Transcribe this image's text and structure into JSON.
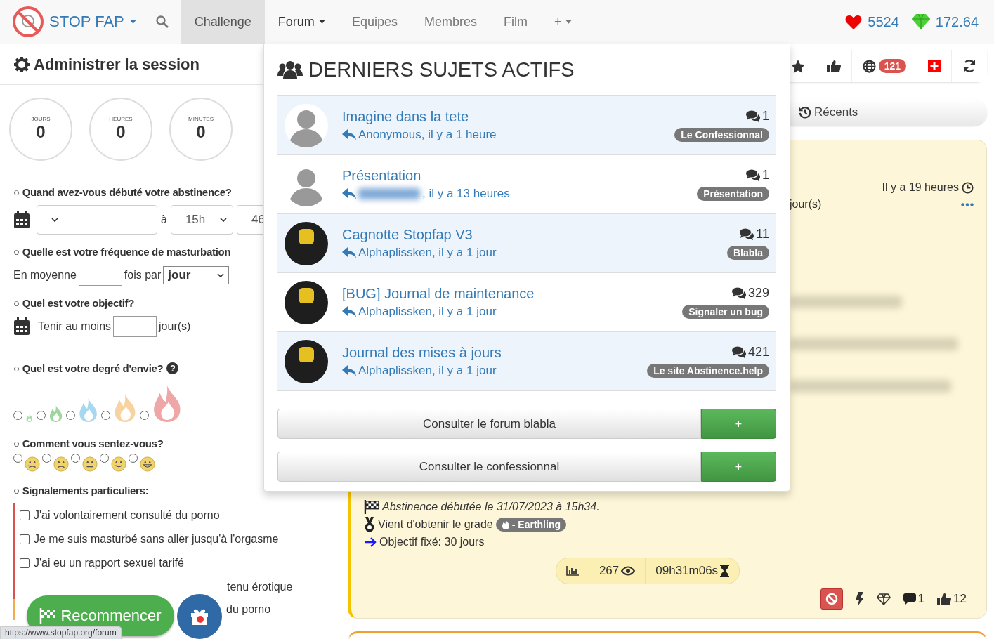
{
  "nav": {
    "brand": "STOP FAP",
    "tabs": [
      {
        "label": "Challenge",
        "selected": true,
        "open": false,
        "dropdown": false
      },
      {
        "label": "Forum",
        "selected": false,
        "open": true,
        "dropdown": true
      },
      {
        "label": "Equipes",
        "selected": false,
        "open": false,
        "dropdown": false
      },
      {
        "label": "Membres",
        "selected": false,
        "open": false,
        "dropdown": false
      },
      {
        "label": "Film",
        "selected": false,
        "open": false,
        "dropdown": false
      },
      {
        "label": "+",
        "selected": false,
        "open": false,
        "dropdown": true
      }
    ],
    "hearts": "5524",
    "gems": "172.64"
  },
  "session": {
    "title": "Administrer la session",
    "counters": [
      {
        "label": "JOURS",
        "value": "0"
      },
      {
        "label": "HEURES",
        "value": "0"
      },
      {
        "label": "MINUTES",
        "value": "0"
      }
    ]
  },
  "form": {
    "bullet": "○",
    "start": {
      "question": "Quand avez-vous débuté votre abstinence?",
      "joiner": "à",
      "hour": "15h",
      "minute": "46"
    },
    "frequency": {
      "question": "Quelle est votre fréquence de masturbation",
      "prefix": "En moyenne",
      "middle": "fois par",
      "unit": "jour"
    },
    "goal": {
      "question": "Quel est votre objectif?",
      "prefix": "Tenir au moins",
      "suffix": "jour(s)"
    },
    "desire": {
      "question": "Quel est votre degré d'envie?",
      "help": "?",
      "levels": [
        {
          "selected": false,
          "color": "#a8dca8"
        },
        {
          "selected": false,
          "color": "#9fd69f"
        },
        {
          "selected": false,
          "color": "#a6d8ef"
        },
        {
          "selected": false,
          "color": "#f7d3a2"
        },
        {
          "selected": false,
          "color": "#eea6a6"
        }
      ]
    },
    "mood": {
      "question": "Comment vous sentez-vous?",
      "options": [
        {
          "selected": false
        },
        {
          "selected": false
        },
        {
          "selected": false
        },
        {
          "selected": false
        },
        {
          "selected": false
        }
      ]
    },
    "reports": {
      "question": "Signalements particuliers:",
      "items": [
        {
          "kind": "full",
          "label": "J'ai volontairement consulté du porno",
          "checked": false
        },
        {
          "kind": "full",
          "label": "Je me suis masturbé sans aller jusqu'à l'orgasme",
          "checked": false
        },
        {
          "kind": "full",
          "label": "J'ai eu un rapport sexuel tarifé",
          "checked": false
        },
        {
          "kind": "partial",
          "label": "tenu érotique"
        },
        {
          "kind": "partial",
          "label": "du porno"
        }
      ]
    }
  },
  "floating": {
    "restart": "Recommencer"
  },
  "status_url": "https://www.stopfap.org/forum",
  "dropdown": {
    "title": "DERNIERS SUJETS ACTIFS",
    "topics": [
      {
        "title": "Imagine dans la tete",
        "byline": "Anonymous, il y a 1 heure",
        "author_hidden": false,
        "replies": "1",
        "category": "Le Confessionnal",
        "kind": "default_avatar"
      },
      {
        "title": "Présentation",
        "byline": ", il y a 13 heures",
        "author_hidden": true,
        "replies": "1",
        "category": "Présentation",
        "kind": "default_avatar"
      },
      {
        "title": "Cagnotte Stopfap V3",
        "byline": "Alphaplissken, il y a 1 jour",
        "author_hidden": false,
        "replies": "11",
        "category": "Blabla",
        "kind": "photo_avatar"
      },
      {
        "title": "[BUG] Journal de maintenance",
        "byline": "Alphaplissken, il y a 1 jour",
        "author_hidden": false,
        "replies": "329",
        "category": "Signaler un bug",
        "kind": "photo_avatar"
      },
      {
        "title": "Journal des mises à jours",
        "byline": "Alphaplissken, il y a 1 jour",
        "author_hidden": false,
        "replies": "421",
        "category": "Le site Abstinence.help",
        "kind": "photo_avatar"
      }
    ],
    "actions": [
      {
        "label": "Consulter le forum blabla",
        "plus": "+"
      },
      {
        "label": "Consulter le confessionnal",
        "plus": "+"
      }
    ]
  },
  "toolbar": {
    "badge": "121"
  },
  "recent_tab": "Récents",
  "post": {
    "time": "Il y a 19 heures",
    "days": "jour(s)",
    "started": "Abstinence débutée le 31/07/2023 à 15h34.",
    "grade_text": "Vient d'obtenir le grade",
    "grade": "- Earthling",
    "goal": "Objectif fixé: 30 jours",
    "views": "267",
    "duration": "09h31m06s",
    "comments": "1",
    "likes": "12"
  }
}
